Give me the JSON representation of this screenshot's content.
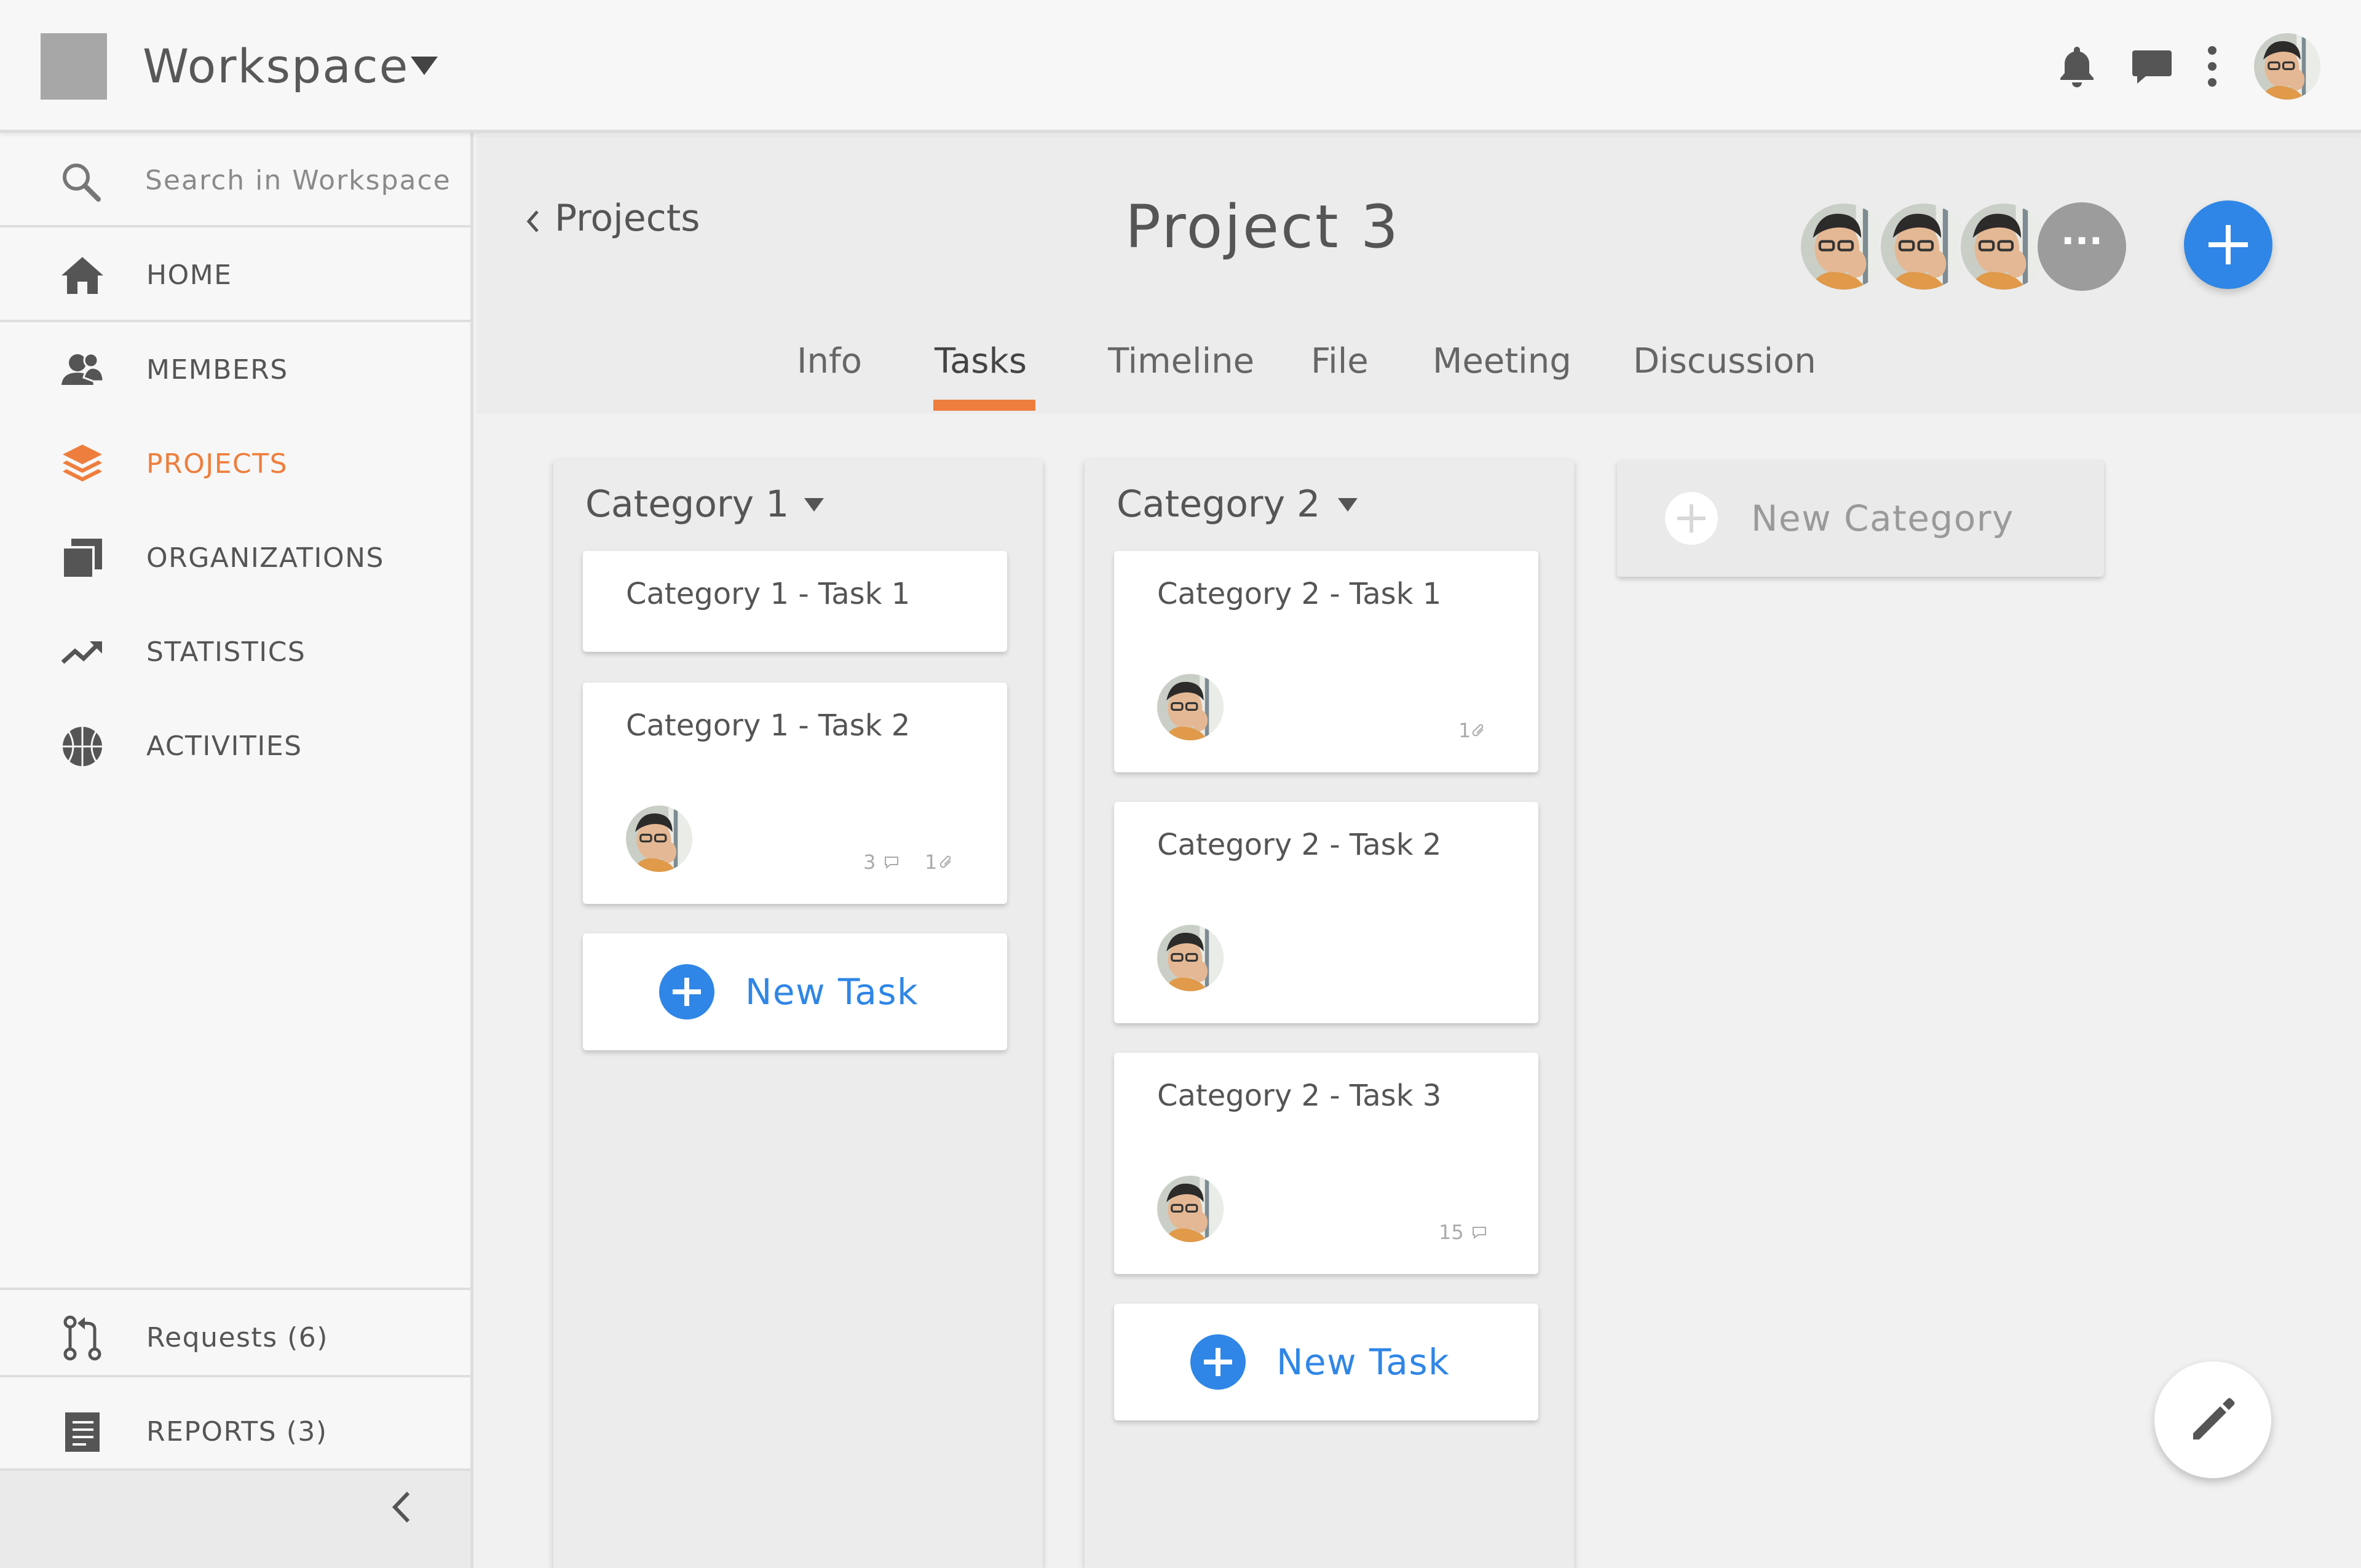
{
  "topbar": {
    "workspace_title": "Workspace"
  },
  "sidebar": {
    "search_placeholder": "Search in Workspace",
    "items": [
      {
        "label": "HOME",
        "icon": "home-icon"
      },
      {
        "label": "MEMBERS",
        "icon": "members-icon"
      },
      {
        "label": "PROJECTS",
        "icon": "layers-icon",
        "active": true
      },
      {
        "label": "ORGANIZATIONS",
        "icon": "organizations-icon"
      },
      {
        "label": "STATISTICS",
        "icon": "trending-up-icon"
      },
      {
        "label": "ACTIVITIES",
        "icon": "basketball-icon"
      }
    ],
    "bottom": [
      {
        "label": "Requests (6)",
        "icon": "pull-request-icon"
      },
      {
        "label": "REPORTS (3)",
        "icon": "report-icon"
      }
    ]
  },
  "project": {
    "back_label": "Projects",
    "title": "Project 3",
    "more_members": "···"
  },
  "tabs": [
    {
      "label": "Info"
    },
    {
      "label": "Tasks",
      "active": true
    },
    {
      "label": "Timeline"
    },
    {
      "label": "File"
    },
    {
      "label": "Meeting"
    },
    {
      "label": "Discussion"
    }
  ],
  "categories": [
    {
      "title": "Category 1",
      "tasks": [
        {
          "title": "Category 1 - Task 1"
        },
        {
          "title": "Category 1 - Task 2",
          "comments": "3",
          "attachments": "1"
        }
      ],
      "new_task_label": "New Task"
    },
    {
      "title": "Category 2",
      "tasks": [
        {
          "title": "Category 2 - Task 1",
          "attachments": "1"
        },
        {
          "title": "Category 2 - Task 2"
        },
        {
          "title": "Category 2 - Task 3",
          "comments": "15"
        }
      ],
      "new_task_label": "New Task"
    }
  ],
  "new_category_label": "New Category",
  "colors": {
    "accent": "#ee7e3d",
    "primary": "#2f86e6",
    "background": "#f1f1f1"
  }
}
